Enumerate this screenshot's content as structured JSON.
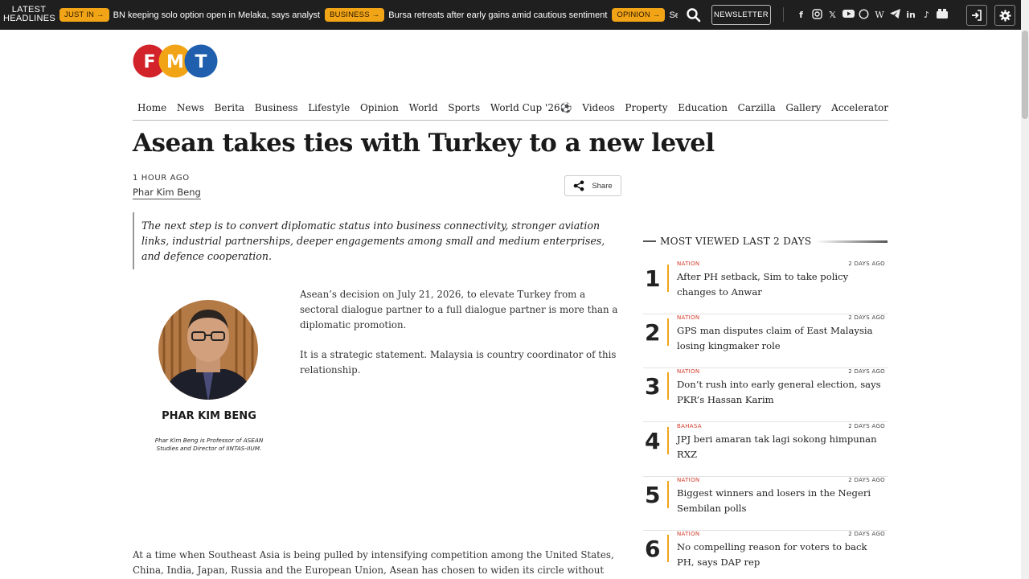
{
  "topbar": {
    "latest_label_1": "LATEST",
    "latest_label_2": "HEADLINES",
    "ticker": [
      {
        "badge": "JUST IN →",
        "text": "BN keeping solo option open in Melaka, says analyst"
      },
      {
        "badge": "BUSINESS →",
        "text": "Bursa retreats after early gains amid cautious sentiment"
      },
      {
        "badge": "OPINION →",
        "text": "Sehari ke"
      }
    ],
    "search_icon": "search-icon",
    "newsletter_label": "NEWSLETTER",
    "social_icons": [
      "facebook-icon",
      "instagram-icon",
      "x-icon",
      "youtube-icon",
      "whatsapp-icon",
      "wikipedia-icon",
      "telegram-icon",
      "linkedin-icon",
      "tiktok-icon",
      "podcast-icon"
    ],
    "login_icon": "login-icon",
    "settings_icon": "gear-icon"
  },
  "header": {
    "logo_letters": [
      "F",
      "M",
      "T"
    ],
    "logo_colors": [
      "#d2232a",
      "#f2a417",
      "#1f5fae"
    ],
    "nav": [
      "Home",
      "News",
      "Berita",
      "Business",
      "Lifestyle",
      "Opinion",
      "World",
      "Sports",
      "World Cup '26⚽",
      "Videos",
      "Property",
      "Education",
      "Carzilla",
      "Gallery",
      "Accelerator"
    ]
  },
  "article": {
    "title": "Asean takes ties with Turkey to a new level",
    "time_ago": "1 HOUR AGO",
    "author": "Phar Kim Beng",
    "share_label": "Share",
    "quote": "The next step is to convert diplomatic status into business connectivity, stronger aviation links, industrial partnerships, deeper engagements among small and medium enterprises, and defence cooperation.",
    "portrait_name": "PHAR KIM BENG",
    "portrait_caption_1": "Phar Kim Beng is Professor of ASEAN",
    "portrait_caption_2": "Studies and Director of IINTAS-IIUM.",
    "paragraph_1": "Asean’s decision on July 21, 2026, to elevate Turkey from a sectoral dialogue partner to a full dialogue partner is more than a diplomatic promotion.",
    "paragraph_2": "It is a strategic statement. Malaysia is country coordinator of this relationship.",
    "paragraph_3": "At a time when Southeast Asia is being pulled by intensifying competition among the United States, China, India, Japan, Russia and the European Union, Asean has chosen to widen its circle without surrendering its"
  },
  "sidebar": {
    "heading": "MOST VIEWED LAST 2 DAYS",
    "accent": "#f2a417",
    "items": [
      {
        "rank": "1",
        "category": "NATION",
        "time": "2 DAYS AGO",
        "headline": "After PH setback, Sim to take policy changes to Anwar"
      },
      {
        "rank": "2",
        "category": "NATION",
        "time": "2 DAYS AGO",
        "headline": "GPS man disputes claim of East Malaysia losing kingmaker role"
      },
      {
        "rank": "3",
        "category": "NATION",
        "time": "2 DAYS AGO",
        "headline": "Don’t rush into early general election, says PKR’s Hassan Karim"
      },
      {
        "rank": "4",
        "category": "BAHASA",
        "time": "2 DAYS AGO",
        "headline": "JPJ beri amaran tak lagi sokong himpunan RXZ"
      },
      {
        "rank": "5",
        "category": "NATION",
        "time": "2 DAYS AGO",
        "headline": "Biggest winners and losers in the Negeri Sembilan polls"
      },
      {
        "rank": "6",
        "category": "NATION",
        "time": "2 DAYS AGO",
        "headline": "No compelling reason for voters to back PH, says DAP rep"
      }
    ]
  }
}
